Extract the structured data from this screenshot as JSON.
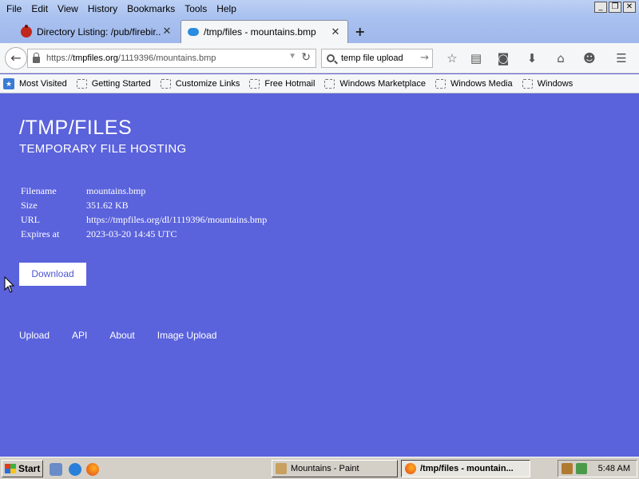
{
  "menubar": {
    "items": [
      "File",
      "Edit",
      "View",
      "History",
      "Bookmarks",
      "Tools",
      "Help"
    ],
    "window_buttons": [
      "_",
      "❐",
      "✕"
    ]
  },
  "tabs": [
    {
      "title": "Directory Listing: /pub/firebir...",
      "icon": "bug-icon",
      "active": false
    },
    {
      "title": "/tmp/files - mountains.bmp",
      "icon": "cloud-upload-icon",
      "active": true
    }
  ],
  "newtab_label": "+",
  "navbar": {
    "url_prefix": "https://",
    "url_host": "tmpfiles.org",
    "url_path": "/1119396/mountains.bmp",
    "search_value": "temp file upload"
  },
  "bookmarks": [
    "Most Visited",
    "Getting Started",
    "Customize Links",
    "Free Hotmail",
    "Windows Marketplace",
    "Windows Media",
    "Windows"
  ],
  "page": {
    "title": "/TMP/FILES",
    "subtitle": "TEMPORARY FILE HOSTING",
    "info": [
      {
        "label": "Filename",
        "value": "mountains.bmp"
      },
      {
        "label": "Size",
        "value": "351.62 KB"
      },
      {
        "label": "URL",
        "value": "https://tmpfiles.org/dl/1119396/mountains.bmp"
      },
      {
        "label": "Expires at",
        "value": "2023-03-20 14:45 UTC"
      }
    ],
    "download_label": "Download",
    "footer_links": [
      "Upload",
      "API",
      "About",
      "Image Upload"
    ],
    "background_color": "#5a62dc"
  },
  "taskbar": {
    "start_label": "Start",
    "tasks": [
      {
        "label": "Mountains - Paint",
        "active": false
      },
      {
        "label": "/tmp/files - mountain...",
        "active": true
      }
    ],
    "clock": "5:48 AM"
  }
}
